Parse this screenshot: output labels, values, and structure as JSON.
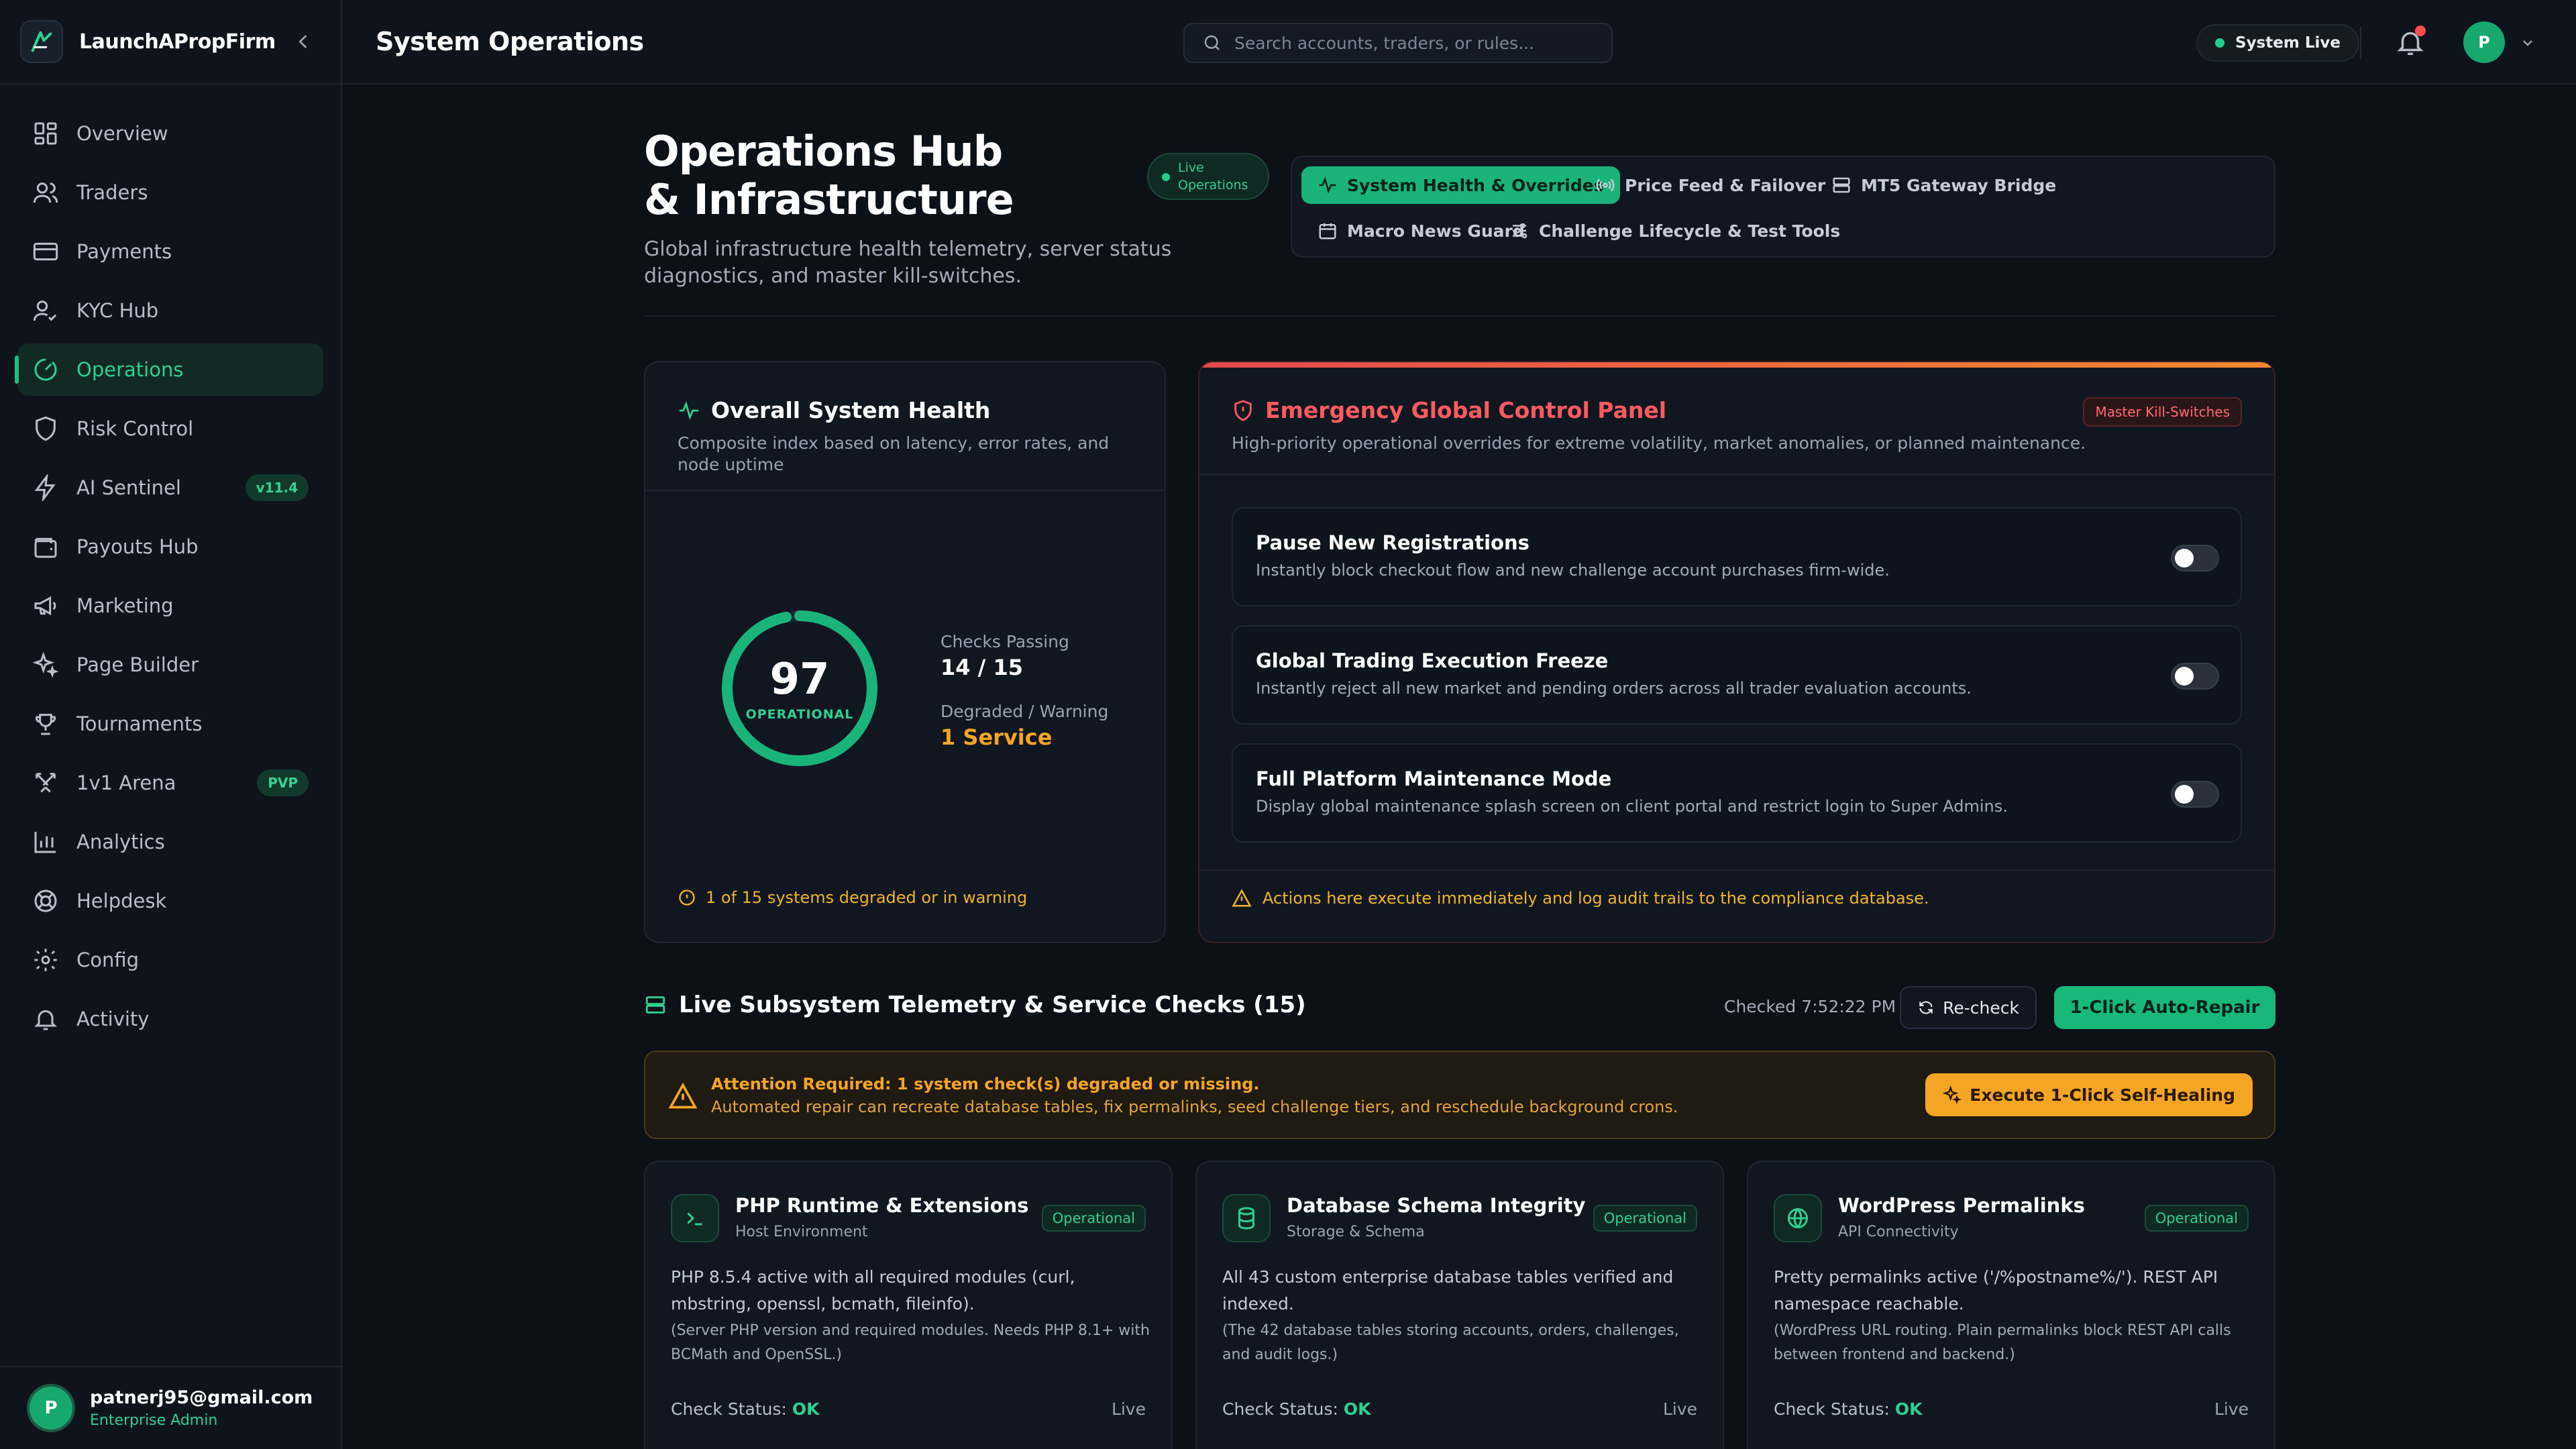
{
  "brand": {
    "name": "LaunchAPropFirm"
  },
  "sidebar": {
    "items": [
      {
        "label": "Overview",
        "icon": "grid-icon"
      },
      {
        "label": "Traders",
        "icon": "users-icon"
      },
      {
        "label": "Payments",
        "icon": "credit-card-icon"
      },
      {
        "label": "KYC Hub",
        "icon": "user-check-icon"
      },
      {
        "label": "Operations",
        "icon": "gauge-icon",
        "active": true
      },
      {
        "label": "Risk Control",
        "icon": "shield-icon"
      },
      {
        "label": "AI Sentinel",
        "icon": "bolt-icon",
        "badge": "v11.4"
      },
      {
        "label": "Payouts Hub",
        "icon": "wallet-icon"
      },
      {
        "label": "Marketing",
        "icon": "megaphone-icon"
      },
      {
        "label": "Page Builder",
        "icon": "sparkles-icon"
      },
      {
        "label": "Tournaments",
        "icon": "trophy-icon"
      },
      {
        "label": "1v1 Arena",
        "icon": "swords-icon",
        "badge": "PVP"
      },
      {
        "label": "Analytics",
        "icon": "bar-chart-icon"
      },
      {
        "label": "Helpdesk",
        "icon": "lifebuoy-icon"
      },
      {
        "label": "Config",
        "icon": "gear-icon"
      },
      {
        "label": "Activity",
        "icon": "bell-icon"
      }
    ]
  },
  "user": {
    "email": "patnerj95@gmail.com",
    "role": "Enterprise Admin",
    "initial": "P"
  },
  "topbar": {
    "title": "System Operations",
    "search_placeholder": "Search accounts, traders, or rules...",
    "status": "System Live",
    "avatar_initial": "P"
  },
  "header": {
    "title": "Operations Hub & Infrastructure",
    "subtitle": "Global infrastructure health telemetry, server status diagnostics, and master kill-switches.",
    "live_badge": "Live Operations",
    "tabs": [
      {
        "label": "System Health & Overrides",
        "icon": "activity-icon",
        "active": true
      },
      {
        "label": "Price Feed & Failover",
        "icon": "radio-icon"
      },
      {
        "label": "MT5 Gateway Bridge",
        "icon": "server-icon"
      },
      {
        "label": "Macro News Guard",
        "icon": "calendar-icon"
      },
      {
        "label": "Challenge Lifecycle & Test Tools",
        "icon": "sliders-icon"
      }
    ]
  },
  "health": {
    "title": "Overall System Health",
    "subtitle": "Composite index based on latency, error rates, and node uptime",
    "score": 97,
    "score_fraction": 0.97,
    "score_label": "OPERATIONAL",
    "checks_label": "Checks Passing",
    "checks_value": "14 / 15",
    "degraded_label": "Degraded / Warning",
    "degraded_value": "1 Service",
    "footer": "1 of 15 systems degraded or in warning"
  },
  "control": {
    "title": "Emergency Global Control Panel",
    "badge": "Master Kill-Switches",
    "subtitle": "High-priority operational overrides for extreme volatility, market anomalies, or planned maintenance.",
    "toggles": [
      {
        "title": "Pause New Registrations",
        "desc": "Instantly block checkout flow and new challenge account purchases firm-wide.",
        "on": false
      },
      {
        "title": "Global Trading Execution Freeze",
        "desc": "Instantly reject all new market and pending orders across all trader evaluation accounts.",
        "on": false
      },
      {
        "title": "Full Platform Maintenance Mode",
        "desc": "Display global maintenance splash screen on client portal and restrict login to Super Admins.",
        "on": false
      }
    ],
    "footer": "Actions here execute immediately and log audit trails to the compliance database."
  },
  "telemetry": {
    "title": "Live Subsystem Telemetry & Service Checks (15)",
    "checked_at": "Checked 7:52:22 PM",
    "recheck_label": "Re-check",
    "repair_label": "1-Click Auto-Repair",
    "alert_title": "Attention Required: 1 system check(s) degraded or missing.",
    "alert_desc": "Automated repair can recreate database tables, fix permalinks, seed challenge tiers, and reschedule background crons.",
    "heal_label": "Execute 1-Click Self-Healing",
    "services": [
      {
        "name": "PHP Runtime & Extensions",
        "category": "Host Environment",
        "status": "Operational",
        "icon": "terminal-icon",
        "desc": "PHP 8.5.4 active with all required modules (curl, mbstring, openssl, bcmath, fileinfo).",
        "note": "(Server PHP version and required modules. Needs PHP 8.1+ with BCMath and OpenSSL.)",
        "check_label": "Check Status:",
        "check_value": "OK",
        "live": "Live"
      },
      {
        "name": "Database Schema Integrity",
        "category": "Storage & Schema",
        "status": "Operational",
        "icon": "database-icon",
        "desc": "All 43 custom enterprise database tables verified and indexed.",
        "note": "(The 42 database tables storing accounts, orders, challenges, and audit logs.)",
        "check_label": "Check Status:",
        "check_value": "OK",
        "live": "Live"
      },
      {
        "name": "WordPress Permalinks",
        "category": "API Connectivity",
        "status": "Operational",
        "icon": "globe-icon",
        "desc": "Pretty permalinks active ('/%postname%/'). REST API namespace reachable.",
        "note": "(WordPress URL routing. Plain permalinks block REST API calls between frontend and backend.)",
        "check_label": "Check Status:",
        "check_value": "OK",
        "live": "Live"
      }
    ]
  },
  "colors": {
    "accent": "#1ab47a",
    "danger": "#ff5a5f",
    "warning": "#f5a524",
    "background": "#0c1017"
  }
}
